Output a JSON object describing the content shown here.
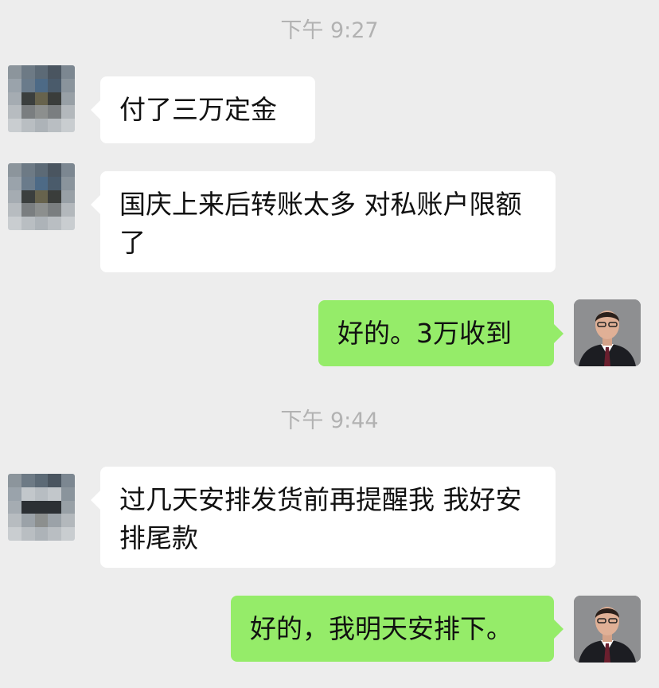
{
  "chat": {
    "timestamps": [
      "下午 9:27",
      "下午 9:44"
    ],
    "messages": [
      {
        "direction": "incoming",
        "text": "付了三万定金"
      },
      {
        "direction": "incoming",
        "text": "国庆上来后转账太多 对私账户限额了"
      },
      {
        "direction": "outgoing",
        "text": "好的。3万收到"
      },
      {
        "direction": "incoming",
        "text": "过几天安排发货前再提醒我 我好安排尾款"
      },
      {
        "direction": "outgoing",
        "text": "好的，我明天安排下。"
      }
    ]
  },
  "colors": {
    "background": "#ededed",
    "incoming_bubble": "#ffffff",
    "outgoing_bubble": "#95ec69",
    "timestamp_text": "#b2b2b2"
  },
  "icons": {
    "contact_avatar": "pixelated-avatar-icon",
    "user_avatar": "user-photo-avatar-icon"
  }
}
